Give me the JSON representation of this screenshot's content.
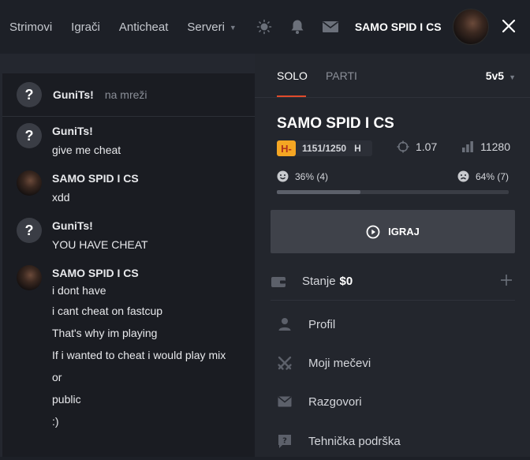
{
  "nav": {
    "items": [
      "Strimovi",
      "Igrači",
      "Anticheat",
      "Serveri"
    ],
    "username": "SAMO SPID I CS"
  },
  "chat": {
    "header": {
      "name": "GuniTs!",
      "status": "na mreži"
    },
    "messages": [
      {
        "author": "GuniTs!",
        "avatar": "question-avatar",
        "lines": [
          "give me cheat"
        ]
      },
      {
        "author": "SAMO SPID I CS",
        "avatar": "user-avatar",
        "lines": [
          "xdd"
        ]
      },
      {
        "author": "GuniTs!",
        "avatar": "question-avatar",
        "lines": [
          "YOU HAVE CHEAT"
        ]
      },
      {
        "author": "SAMO SPID I CS",
        "avatar": "user-avatar",
        "lines": [
          "i dont have",
          "i cant cheat on fastcup",
          "That's why im playing",
          "If i wanted to cheat i would play mix",
          "or",
          "public",
          ":)"
        ]
      }
    ]
  },
  "panel": {
    "tabs": {
      "solo": "SOLO",
      "parti": "PARTI"
    },
    "mode": "5v5",
    "username": "SAMO SPID I CS",
    "level": "H-",
    "elo": "1151/1250",
    "rank": "H",
    "kd": "1.07",
    "games": "11280",
    "wins": "36% (4)",
    "losses": "64% (7)",
    "win_fraction": 0.36,
    "play_label": "IGRAJ",
    "balance_label": "Stanje",
    "balance_amount": "$0",
    "menu": [
      "Profil",
      "Moji mečevi",
      "Razgovori",
      "Tehnička podrška"
    ]
  },
  "colors": {
    "accent": "#e14b2c",
    "level": "#f5a623"
  }
}
